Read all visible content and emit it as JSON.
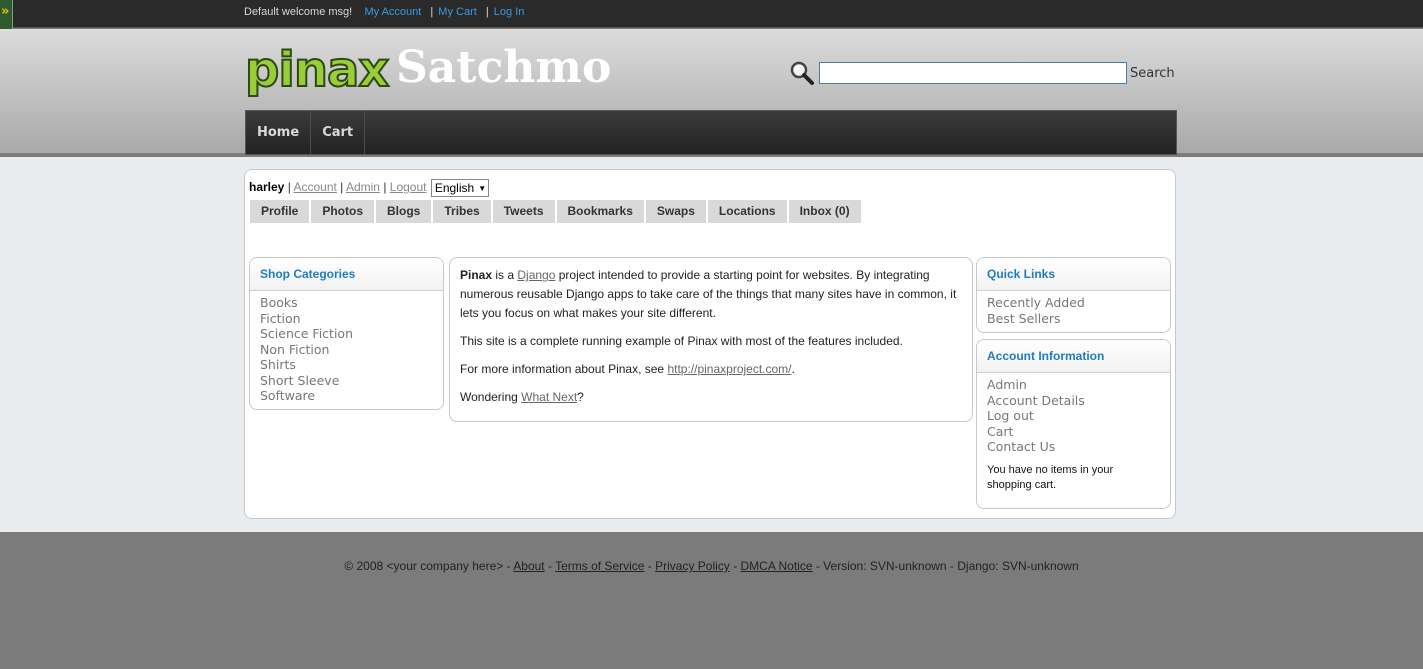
{
  "topbar": {
    "corner_glyph": "»",
    "welcome": "Default welcome msg!",
    "links": [
      "My Account",
      "My Cart",
      "Log In"
    ],
    "separator": "|"
  },
  "header": {
    "logo_text": "pinax",
    "site_title": "Satchmo",
    "search_value": "",
    "search_label": "Search",
    "search_icon": "search-icon"
  },
  "nav": {
    "items": [
      "Home",
      "Cart"
    ]
  },
  "user": {
    "name": "harley",
    "links": [
      "Account",
      "Admin",
      "Logout"
    ],
    "language": "English"
  },
  "tabs": [
    "Profile",
    "Photos",
    "Blogs",
    "Tribes",
    "Tweets",
    "Bookmarks",
    "Swaps",
    "Locations",
    "Inbox (0)"
  ],
  "shop_categories": {
    "title": "Shop Categories",
    "items": [
      "Books",
      "Fiction",
      "Science Fiction",
      "Non Fiction",
      "Shirts",
      "Short Sleeve",
      "Software"
    ]
  },
  "main": {
    "p1_bold": "Pinax",
    "p1_a": " is a ",
    "p1_link": "Django",
    "p1_b": " project intended to provide a starting point for websites. By integrating numerous reusable Django apps to take care of the things that many sites have in common, it lets you focus on what makes your site different.",
    "p2": "This site is a complete running example of Pinax with most of the features included.",
    "p3_a": "For more information about Pinax, see ",
    "p3_link": "http://pinaxproject.com/",
    "p3_b": ".",
    "p4_a": "Wondering ",
    "p4_link": "What Next",
    "p4_b": "?"
  },
  "quick_links": {
    "title": "Quick Links",
    "items": [
      "Recently Added",
      "Best Sellers"
    ]
  },
  "account_info": {
    "title": "Account Information",
    "items": [
      "Admin",
      "Account Details",
      "Log out",
      "Cart",
      "Contact Us"
    ],
    "cart_note": "You have no items in your shopping cart."
  },
  "footer": {
    "copyright": "© 2008 <your company here> - ",
    "links": [
      "About",
      "Terms of Service",
      "Privacy Policy",
      "DMCA Notice"
    ],
    "separator": " - ",
    "version": " - Version: SVN-unknown - Django: SVN-unknown"
  }
}
